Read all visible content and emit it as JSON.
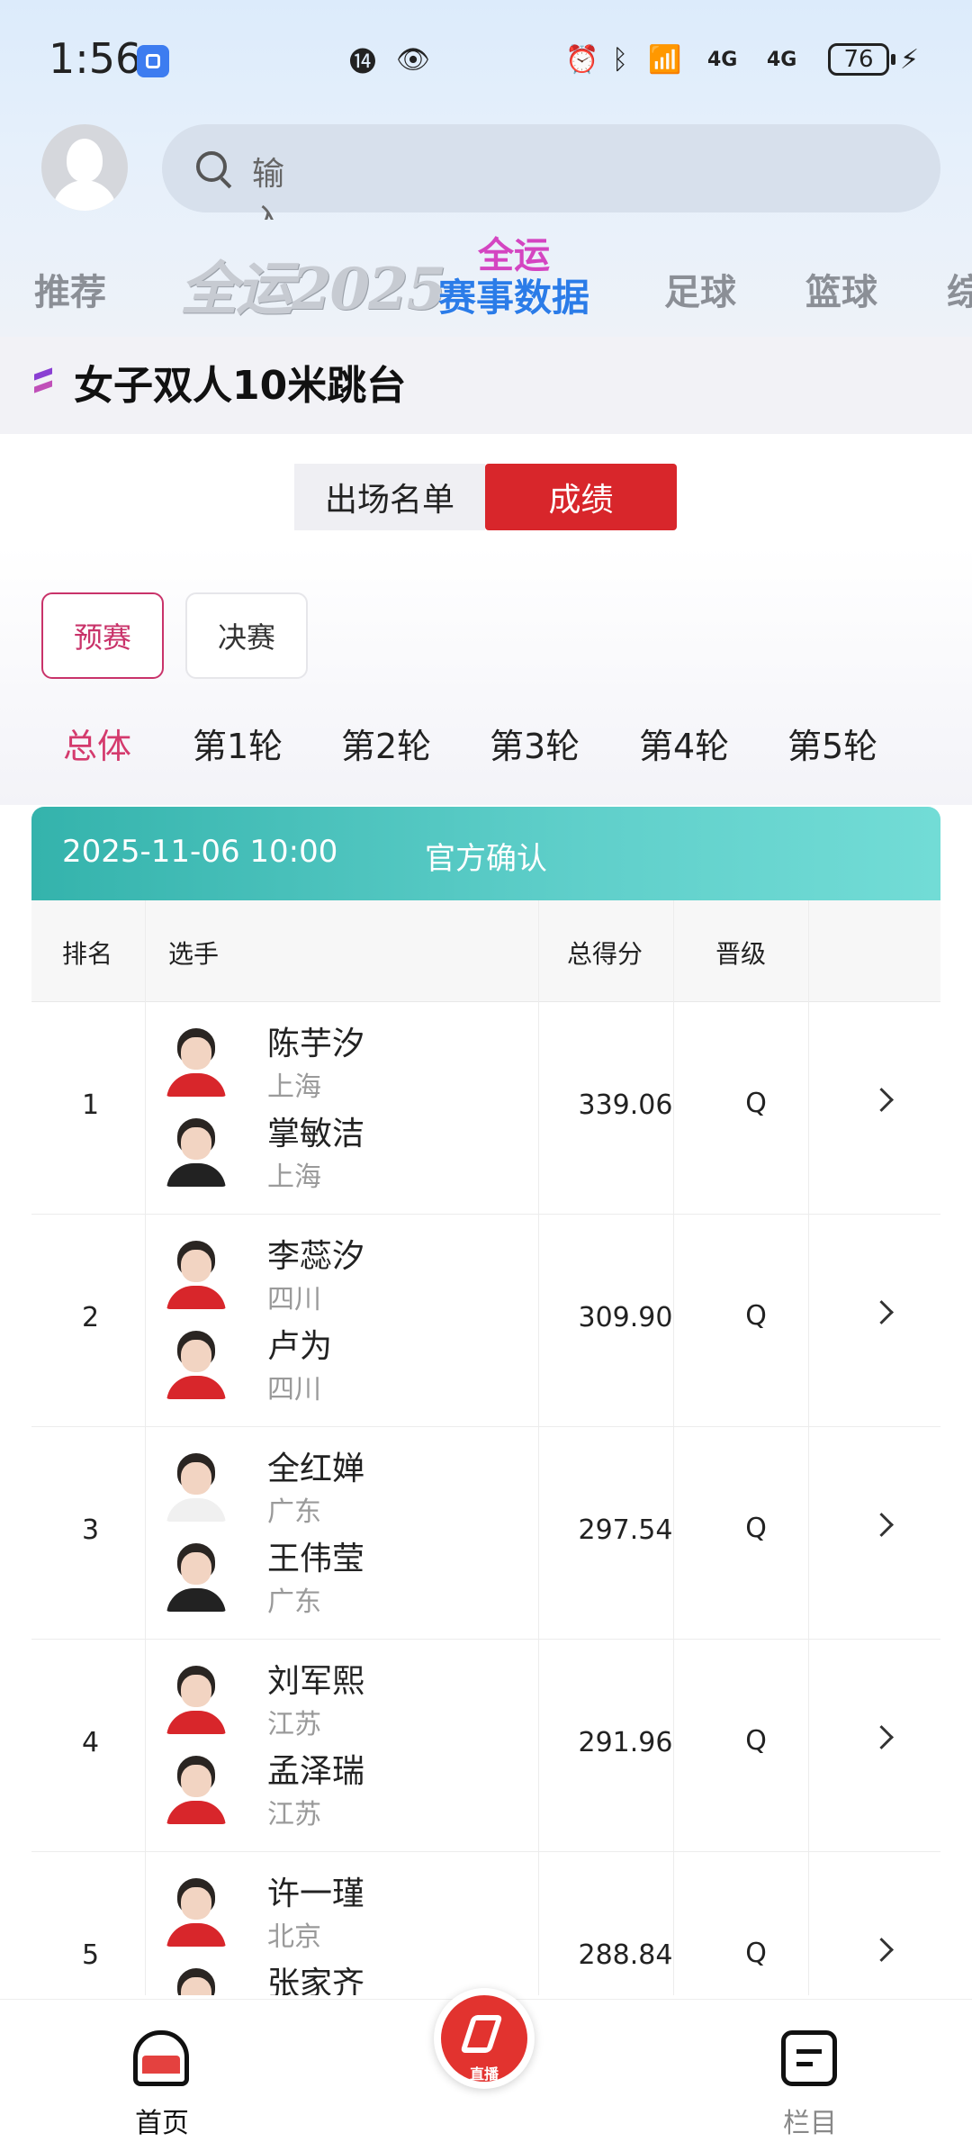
{
  "status": {
    "time": "1:56",
    "battery": "76",
    "network1": "4G",
    "network2": "4G"
  },
  "search": {
    "placeholder": "输入您感兴趣的内容"
  },
  "nav": {
    "items": [
      "推荐",
      "足球",
      "篮球",
      "综"
    ],
    "logo_year": "全运2025",
    "logo_line1": "全运",
    "logo_line2": "赛事数据"
  },
  "section": {
    "title": "女子双人10米跳台"
  },
  "segments": {
    "list_label": "出场名单",
    "score_label": "成绩"
  },
  "stage_chips": {
    "prelim": "预赛",
    "final": "决赛"
  },
  "round_tabs": [
    "总体",
    "第1轮",
    "第2轮",
    "第3轮",
    "第4轮",
    "第5轮"
  ],
  "results": {
    "datetime": "2025-11-06 10:00",
    "status": "官方确认",
    "headers": {
      "rank": "排名",
      "athlete": "选手",
      "score": "总得分",
      "qualify": "晋级"
    },
    "rows": [
      {
        "rank": "1",
        "a1": "陈芋汐",
        "p1": "上海",
        "a2": "掌敏洁",
        "p2": "上海",
        "score": "339.06",
        "q": "Q"
      },
      {
        "rank": "2",
        "a1": "李蕊汐",
        "p1": "四川",
        "a2": "卢为",
        "p2": "四川",
        "score": "309.90",
        "q": "Q"
      },
      {
        "rank": "3",
        "a1": "全红婵",
        "p1": "广东",
        "a2": "王伟莹",
        "p2": "广东",
        "score": "297.54",
        "q": "Q"
      },
      {
        "rank": "4",
        "a1": "刘军熙",
        "p1": "江苏",
        "a2": "孟泽瑞",
        "p2": "江苏",
        "score": "291.96",
        "q": "Q"
      },
      {
        "rank": "5",
        "a1": "许一瑾",
        "p1": "北京",
        "a2": "张家齐",
        "p2": "",
        "score": "288.84",
        "q": "Q"
      }
    ]
  },
  "bottom": {
    "home": "首页",
    "live": "直播",
    "columns": "栏目"
  }
}
